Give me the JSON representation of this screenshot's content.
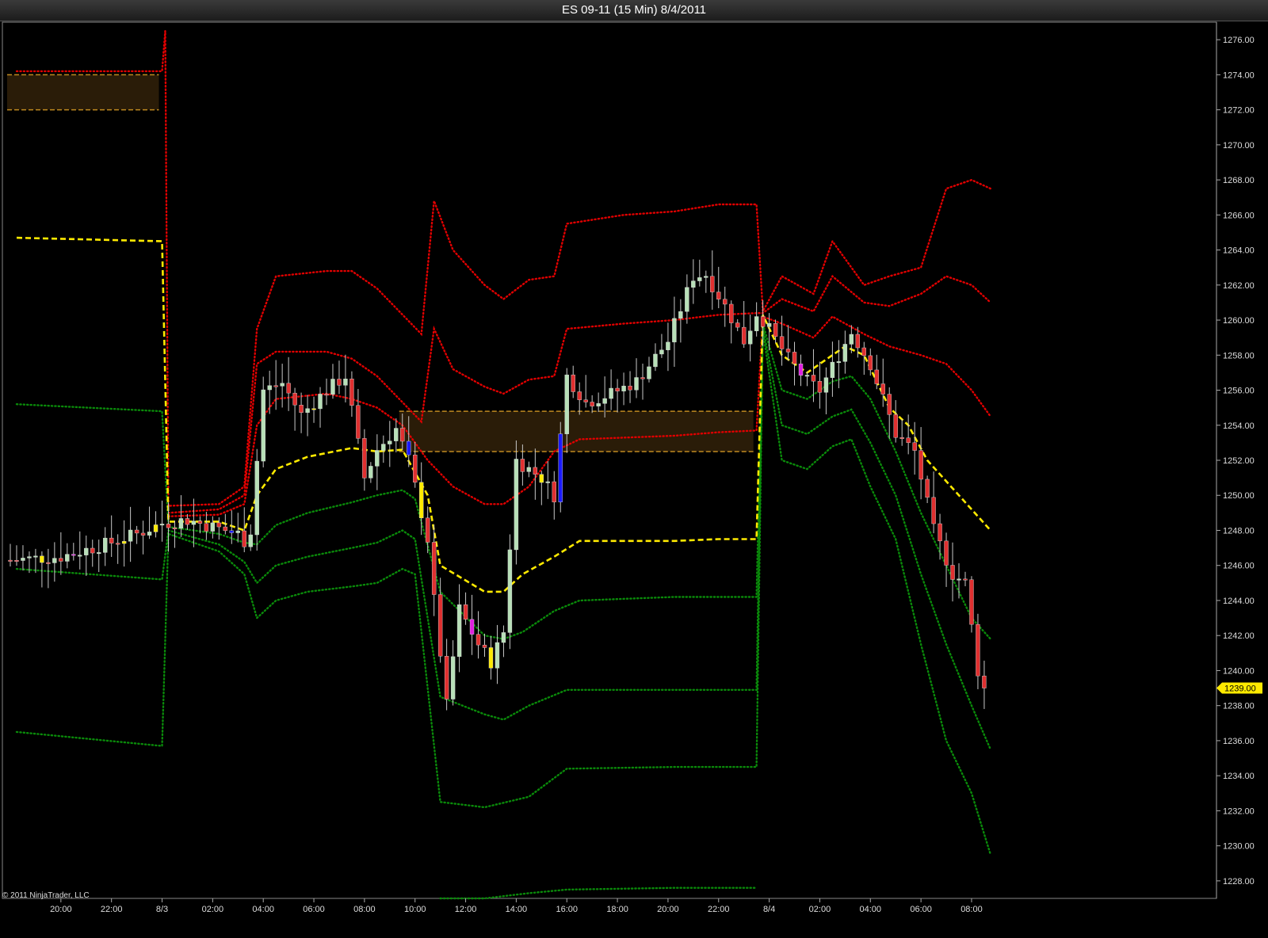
{
  "window": {
    "title": "ES 09-11 (15 Min)  8/4/2011"
  },
  "footer": {
    "copyright": "© 2011 NinjaTrader, LLC"
  },
  "colors": {
    "background": "#000000",
    "bull_candle": "#b8e0b8",
    "bear_candle": "#e03030",
    "vwap": "#ffea00",
    "upper_band": "#e00000",
    "lower_band": "#0a8a0a",
    "value_area": "#2a1c08",
    "value_area_edge": "#c08a20",
    "price_marker": "#ffea00"
  },
  "chart_data": {
    "type": "candlestick",
    "instrument": "ES 09-11",
    "interval": "15 Min",
    "date": "8/4/2011",
    "ylim": [
      1227,
      1277
    ],
    "y_ticks": [
      1228,
      1230,
      1232,
      1234,
      1236,
      1238,
      1240,
      1242,
      1244,
      1246,
      1248,
      1250,
      1252,
      1254,
      1256,
      1258,
      1260,
      1262,
      1264,
      1266,
      1268,
      1270,
      1272,
      1274,
      1276
    ],
    "y_tick_labels": [
      "1228.00",
      "1230.00",
      "1232.00",
      "1234.00",
      "1236.00",
      "1238.00",
      "1240.00",
      "1242.00",
      "1244.00",
      "1246.00",
      "1248.00",
      "1250.00",
      "1252.00",
      "1254.00",
      "1256.00",
      "1258.00",
      "1260.00",
      "1262.00",
      "1264.00",
      "1266.00",
      "1268.00",
      "1270.00",
      "1272.00",
      "1274.00",
      "1276.00"
    ],
    "x_tick_labels": [
      "20:00",
      "22:00",
      "8/3",
      "02:00",
      "04:00",
      "06:00",
      "08:00",
      "10:00",
      "12:00",
      "14:00",
      "16:00",
      "18:00",
      "20:00",
      "22:00",
      "8/4",
      "02:00",
      "04:00",
      "06:00",
      "08:00"
    ],
    "x_tick_bar_index": [
      8,
      16,
      24,
      32,
      40,
      48,
      56,
      64,
      72,
      80,
      88,
      96,
      104,
      112,
      120,
      128,
      136,
      144,
      152
    ],
    "bar_count": 155,
    "last_price": 1239,
    "last_price_label": "1239.00",
    "value_areas": [
      {
        "start_bar": 0,
        "end_bar": 23,
        "high": 1274,
        "low": 1272
      },
      {
        "start_bar": 62,
        "end_bar": 117,
        "high": 1254.8,
        "low": 1252.5
      }
    ],
    "vwap_anchors": [
      [
        1,
        1264.7
      ],
      [
        24,
        1264.5
      ],
      [
        25,
        1248.5
      ],
      [
        33,
        1248.5
      ],
      [
        37,
        1248
      ],
      [
        39,
        1250
      ],
      [
        42,
        1251.5
      ],
      [
        47,
        1252.2
      ],
      [
        54,
        1252.7
      ],
      [
        58,
        1252.5
      ],
      [
        62,
        1252.6
      ],
      [
        66,
        1250
      ],
      [
        68,
        1246
      ],
      [
        75,
        1244.5
      ],
      [
        78,
        1244.5
      ],
      [
        81,
        1245.5
      ],
      [
        86,
        1246.5
      ],
      [
        90,
        1247.4
      ],
      [
        105,
        1247.4
      ],
      [
        112,
        1247.5
      ],
      [
        118,
        1247.5
      ],
      [
        119,
        1260.3
      ],
      [
        122,
        1258
      ],
      [
        126,
        1257
      ],
      [
        130,
        1258
      ],
      [
        132,
        1258.5
      ],
      [
        135,
        1258
      ],
      [
        139,
        1255
      ],
      [
        142,
        1254
      ],
      [
        145,
        1252
      ],
      [
        150,
        1250
      ],
      [
        155,
        1248
      ]
    ],
    "upper_bands": [
      [
        [
          1,
          1274.2
        ],
        [
          24,
          1274.2
        ],
        [
          24.5,
          1276.5
        ],
        [
          25,
          1249.4
        ],
        [
          33,
          1249.5
        ],
        [
          37,
          1250.5
        ],
        [
          39,
          1259.5
        ],
        [
          42,
          1262.5
        ],
        [
          50,
          1262.8
        ],
        [
          54,
          1262.8
        ],
        [
          58,
          1261.8
        ],
        [
          65,
          1259.2
        ],
        [
          67,
          1266.8
        ],
        [
          70,
          1264
        ],
        [
          75,
          1262
        ],
        [
          78,
          1261.2
        ],
        [
          82,
          1262.3
        ],
        [
          86,
          1262.5
        ],
        [
          88,
          1265.5
        ],
        [
          97,
          1266
        ],
        [
          105,
          1266.2
        ],
        [
          112,
          1266.6
        ],
        [
          118,
          1266.6
        ],
        [
          119,
          1260.5
        ],
        [
          122,
          1262.5
        ],
        [
          127,
          1261.5
        ],
        [
          130,
          1264.5
        ],
        [
          135,
          1262
        ],
        [
          139,
          1262.5
        ],
        [
          144,
          1263
        ],
        [
          148,
          1267.5
        ],
        [
          152,
          1268
        ],
        [
          155,
          1267.5
        ]
      ],
      [
        [
          25,
          1249
        ],
        [
          33,
          1249.2
        ],
        [
          37,
          1250
        ],
        [
          39,
          1257.5
        ],
        [
          42,
          1258.2
        ],
        [
          50,
          1258.2
        ],
        [
          54,
          1257.8
        ],
        [
          58,
          1256.8
        ],
        [
          65,
          1254.2
        ],
        [
          67,
          1259.5
        ],
        [
          70,
          1257.2
        ],
        [
          75,
          1256.2
        ],
        [
          78,
          1255.8
        ],
        [
          82,
          1256.6
        ],
        [
          86,
          1256.8
        ],
        [
          88,
          1259.5
        ],
        [
          97,
          1259.8
        ],
        [
          105,
          1260
        ],
        [
          112,
          1260.3
        ],
        [
          118,
          1260.4
        ],
        [
          119,
          1260.4
        ],
        [
          122,
          1261.2
        ],
        [
          127,
          1260.5
        ],
        [
          130,
          1262.5
        ],
        [
          135,
          1261
        ],
        [
          139,
          1260.8
        ],
        [
          144,
          1261.5
        ],
        [
          148,
          1262.5
        ],
        [
          152,
          1262
        ],
        [
          155,
          1261
        ]
      ],
      [
        [
          25,
          1248.8
        ],
        [
          33,
          1248.9
        ],
        [
          37,
          1249.5
        ],
        [
          39,
          1254
        ],
        [
          42,
          1255.5
        ],
        [
          50,
          1255.8
        ],
        [
          54,
          1255.5
        ],
        [
          58,
          1255
        ],
        [
          62,
          1254
        ],
        [
          66,
          1252
        ],
        [
          70,
          1250.5
        ],
        [
          75,
          1249.5
        ],
        [
          78,
          1249.5
        ],
        [
          82,
          1250.5
        ],
        [
          86,
          1252.5
        ],
        [
          90,
          1253.2
        ],
        [
          105,
          1253.4
        ],
        [
          112,
          1253.6
        ],
        [
          118,
          1253.7
        ],
        [
          119,
          1260.2
        ],
        [
          122,
          1259.8
        ],
        [
          127,
          1259
        ],
        [
          130,
          1260.2
        ],
        [
          135,
          1259.2
        ],
        [
          139,
          1258.5
        ],
        [
          144,
          1258
        ],
        [
          148,
          1257.5
        ],
        [
          152,
          1256
        ],
        [
          155,
          1254.5
        ]
      ]
    ],
    "lower_bands": [
      [
        [
          1,
          1255.2
        ],
        [
          24,
          1254.8
        ],
        [
          25,
          1248.2
        ],
        [
          33,
          1247.8
        ],
        [
          37,
          1247.3
        ],
        [
          39,
          1247.2
        ],
        [
          42,
          1248.3
        ],
        [
          47,
          1249
        ],
        [
          54,
          1249.6
        ],
        [
          58,
          1250
        ],
        [
          62,
          1250.3
        ],
        [
          64,
          1249.8
        ],
        [
          68,
          1244.5
        ],
        [
          75,
          1242
        ],
        [
          78,
          1241.8
        ],
        [
          81,
          1242.2
        ],
        [
          86,
          1243.4
        ],
        [
          90,
          1244
        ],
        [
          105,
          1244.2
        ],
        [
          112,
          1244.2
        ],
        [
          118,
          1244.2
        ],
        [
          119,
          1259.8
        ],
        [
          122,
          1256
        ],
        [
          126,
          1255.5
        ],
        [
          130,
          1256.5
        ],
        [
          133,
          1256.8
        ],
        [
          136,
          1255.5
        ],
        [
          140,
          1252.5
        ],
        [
          144,
          1249
        ],
        [
          148,
          1246
        ],
        [
          152,
          1243
        ],
        [
          155,
          1241.8
        ]
      ],
      [
        [
          1,
          1245.8
        ],
        [
          24,
          1245.2
        ],
        [
          25,
          1248
        ],
        [
          33,
          1247.2
        ],
        [
          37,
          1246.2
        ],
        [
          39,
          1245
        ],
        [
          42,
          1246
        ],
        [
          47,
          1246.5
        ],
        [
          54,
          1247
        ],
        [
          58,
          1247.3
        ],
        [
          62,
          1248
        ],
        [
          64,
          1247.5
        ],
        [
          68,
          1238.5
        ],
        [
          75,
          1237.5
        ],
        [
          78,
          1237.2
        ],
        [
          82,
          1238
        ],
        [
          88,
          1238.9
        ],
        [
          105,
          1238.9
        ],
        [
          112,
          1238.9
        ],
        [
          118,
          1238.9
        ],
        [
          119,
          1259.6
        ],
        [
          122,
          1254
        ],
        [
          126,
          1253.5
        ],
        [
          130,
          1254.5
        ],
        [
          133,
          1254.9
        ],
        [
          136,
          1253
        ],
        [
          140,
          1250
        ],
        [
          144,
          1245.5
        ],
        [
          148,
          1241.5
        ],
        [
          152,
          1238
        ],
        [
          155,
          1235.5
        ]
      ],
      [
        [
          1,
          1236.5
        ],
        [
          24,
          1235.7
        ],
        [
          25,
          1247.8
        ],
        [
          33,
          1246.8
        ],
        [
          37,
          1245.5
        ],
        [
          39,
          1243
        ],
        [
          42,
          1244
        ],
        [
          47,
          1244.5
        ],
        [
          54,
          1244.8
        ],
        [
          58,
          1245
        ],
        [
          62,
          1245.8
        ],
        [
          64,
          1245.5
        ],
        [
          68,
          1232.5
        ],
        [
          75,
          1232.2
        ],
        [
          82,
          1232.8
        ],
        [
          88,
          1234.4
        ],
        [
          105,
          1234.5
        ],
        [
          112,
          1234.5
        ],
        [
          118,
          1234.5
        ],
        [
          119,
          1259.4
        ],
        [
          122,
          1252
        ],
        [
          126,
          1251.5
        ],
        [
          130,
          1252.8
        ],
        [
          133,
          1253.2
        ],
        [
          136,
          1250.5
        ],
        [
          140,
          1247.5
        ],
        [
          144,
          1241.5
        ],
        [
          148,
          1236
        ],
        [
          152,
          1233
        ],
        [
          155,
          1229.5
        ]
      ],
      [
        [
          68,
          1227
        ],
        [
          75,
          1227
        ],
        [
          82,
          1227.3
        ],
        [
          88,
          1227.5
        ],
        [
          105,
          1227.6
        ],
        [
          112,
          1227.6
        ],
        [
          118,
          1227.6
        ]
      ]
    ],
    "price_anchors": [
      [
        0,
        1246.3
      ],
      [
        8,
        1246.5
      ],
      [
        15,
        1247.2
      ],
      [
        20,
        1247.8
      ],
      [
        24,
        1248.4
      ],
      [
        28,
        1248.6
      ],
      [
        32,
        1248.2
      ],
      [
        36,
        1247.8
      ],
      [
        37,
        1247.4
      ],
      [
        38,
        1248
      ],
      [
        40,
        1256
      ],
      [
        43,
        1256.4
      ],
      [
        46,
        1254.6
      ],
      [
        50,
        1256
      ],
      [
        53,
        1256.8
      ],
      [
        56,
        1251
      ],
      [
        58,
        1252.6
      ],
      [
        61,
        1253.8
      ],
      [
        63,
        1252
      ],
      [
        66,
        1247.5
      ],
      [
        67,
        1244
      ],
      [
        69,
        1238
      ],
      [
        71,
        1243.5
      ],
      [
        74,
        1241.5
      ],
      [
        76,
        1240.5
      ],
      [
        78,
        1242.2
      ],
      [
        80,
        1252
      ],
      [
        84,
        1251
      ],
      [
        86,
        1250
      ],
      [
        88,
        1256.8
      ],
      [
        91,
        1255.3
      ],
      [
        95,
        1255.8
      ],
      [
        99,
        1256.5
      ],
      [
        104,
        1258.8
      ],
      [
        108,
        1262.5
      ],
      [
        110,
        1262.6
      ],
      [
        113,
        1260.8
      ],
      [
        116,
        1258.8
      ],
      [
        118,
        1260.4
      ],
      [
        119,
        1260
      ],
      [
        123,
        1257.8
      ],
      [
        126,
        1256.5
      ],
      [
        128,
        1256
      ],
      [
        131,
        1258
      ],
      [
        133,
        1259.3
      ],
      [
        136,
        1257.5
      ],
      [
        140,
        1253.5
      ],
      [
        143,
        1252.5
      ],
      [
        146,
        1248
      ],
      [
        149,
        1245.5
      ],
      [
        151,
        1245
      ],
      [
        153,
        1240
      ],
      [
        155,
        1239
      ]
    ]
  }
}
